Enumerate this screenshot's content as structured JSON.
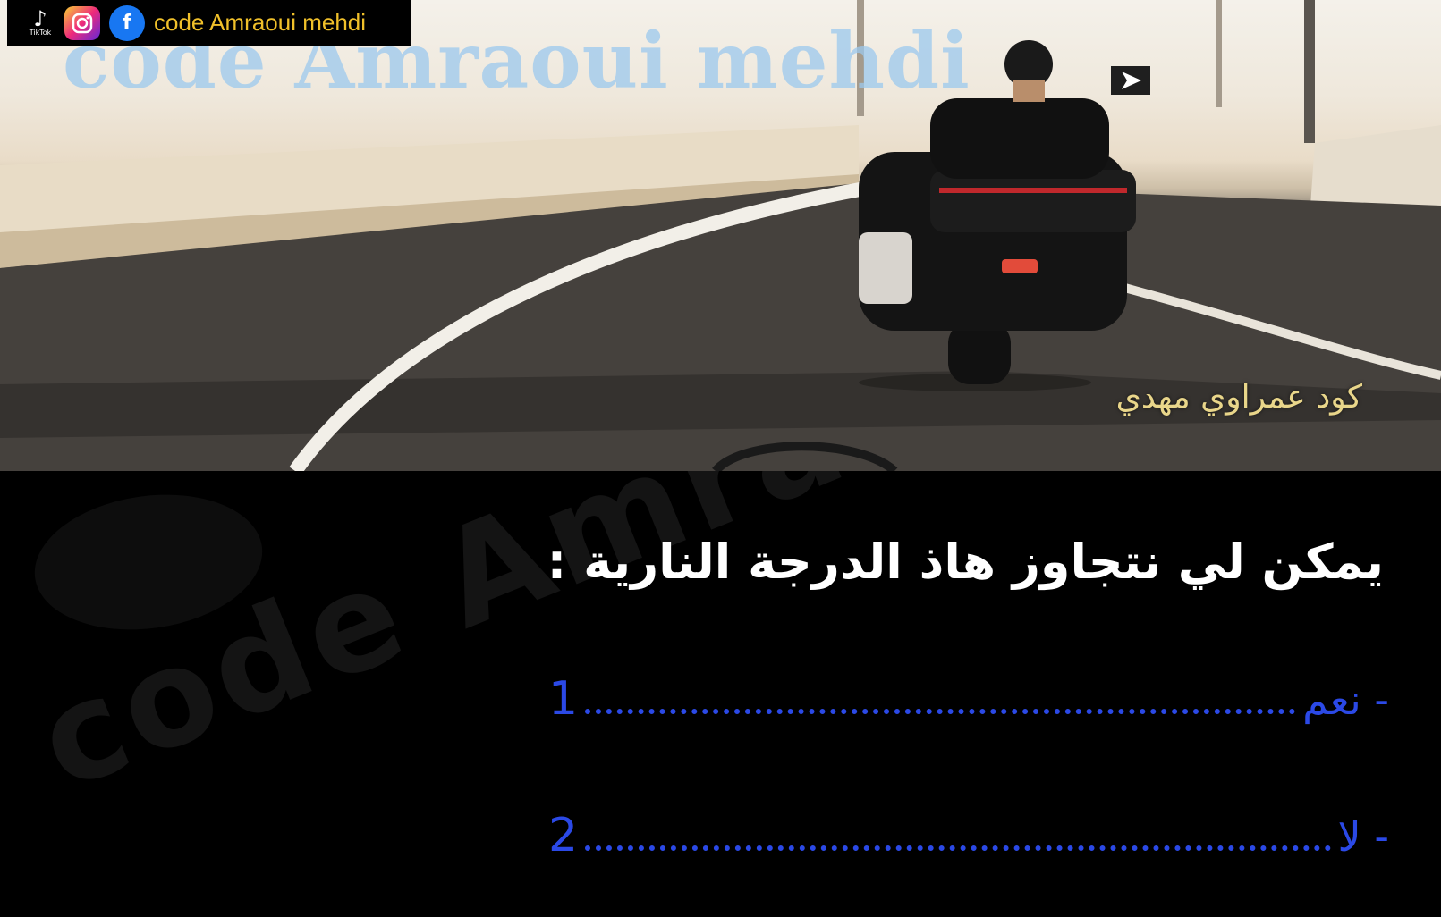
{
  "badge": {
    "tiktok_label": "TikTok",
    "channel_name": "code Amraoui mehdi",
    "icons": [
      "tiktok-icon",
      "instagram-icon",
      "facebook-icon"
    ]
  },
  "scene": {
    "watermark": "code Amraoui mehdi",
    "caption": "كود عمراوي مهدي"
  },
  "quiz": {
    "watermark": "code Amraoui mehdi",
    "question": "يمكن لي نتجاوز هاذ الدرجة النارية :",
    "answers": [
      {
        "label": "- نعم",
        "number": "1"
      },
      {
        "label": "- لا",
        "number": "2"
      }
    ]
  },
  "colors": {
    "answer": "#2b49e6",
    "badge_text": "#f0c02a",
    "caption": "#e9d68a"
  }
}
